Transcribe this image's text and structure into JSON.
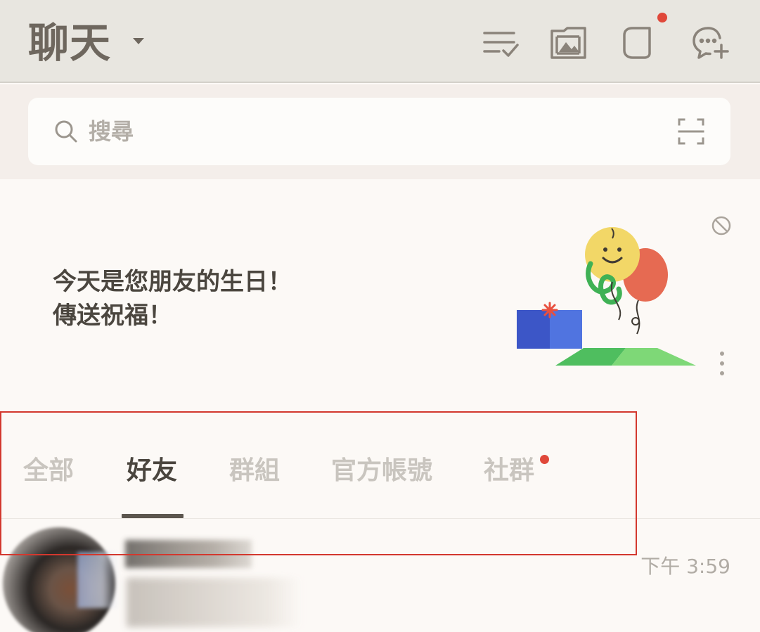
{
  "header": {
    "title": "聊天",
    "icons": [
      "edit-chats-icon",
      "album-icon",
      "open-chat-icon",
      "new-chat-icon"
    ],
    "notification_dot_color": "#e0483a"
  },
  "search": {
    "placeholder": "搜尋"
  },
  "banner": {
    "line1": "今天是您朋友的生日！",
    "line2": "傳送祝福！"
  },
  "tabs": {
    "items": [
      {
        "label": "全部",
        "active": false
      },
      {
        "label": "好友",
        "active": true
      },
      {
        "label": "群組",
        "active": false
      },
      {
        "label": "官方帳號",
        "active": false
      },
      {
        "label": "社群",
        "active": false,
        "badge": true
      }
    ],
    "badge_color": "#e0483a"
  },
  "chat_list": {
    "items": [
      {
        "time": "下午 3:59"
      }
    ]
  },
  "colors": {
    "accent": "#d3382e",
    "text_primary": "#4a453e",
    "text_muted": "#c9c5bf",
    "header_bg": "#e8e6e0"
  }
}
